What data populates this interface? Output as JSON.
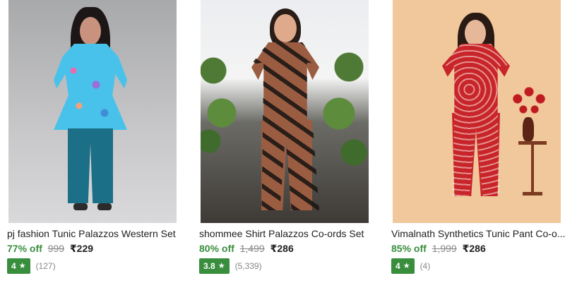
{
  "products": [
    {
      "title": "pj fashion Tunic Palazzos Western Set",
      "discount": "77% off",
      "mrp": "999",
      "price": "₹229",
      "rating": "4",
      "reviews": "(127)"
    },
    {
      "title": "shommee Shirt Palazzos Co-ords Set",
      "discount": "80% off",
      "mrp": "1,499",
      "price": "₹286",
      "rating": "3.8",
      "reviews": "(5,339)"
    },
    {
      "title": "Vimalnath Synthetics Tunic Pant Co-o...",
      "discount": "85% off",
      "mrp": "1,999",
      "price": "₹286",
      "rating": "4",
      "reviews": "(4)"
    }
  ],
  "icons": {
    "rating_star": "star-icon"
  },
  "colors": {
    "discount_green": "#388e3c",
    "badge_green": "#388e3c",
    "muted": "#878787",
    "text": "#212121"
  }
}
